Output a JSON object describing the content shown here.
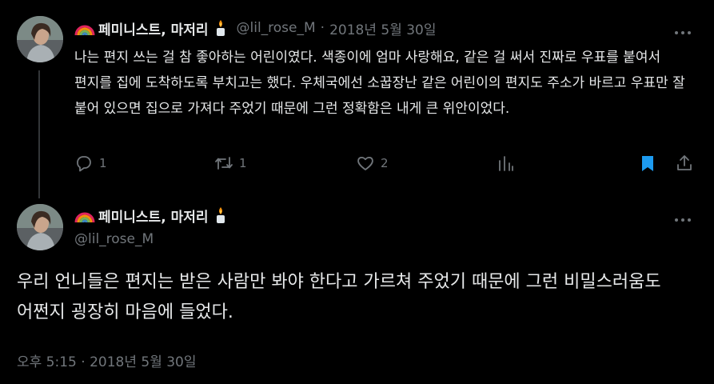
{
  "first_tweet": {
    "display_name": "페미니스트, 마저리",
    "handle": "@lil_rose_M",
    "separator": "·",
    "date": "2018년 5월 30일",
    "text": "나는 편지 쓰는 걸 참 좋아하는 어린이였다. 색종이에 엄마 사랑해요, 같은 걸 써서 진짜로 우표를 붙여서 편지를 집에 도착하도록 부치고는 했다. 우체국에선 소꿉장난 같은 어린이의 편지도 주소가 바르고 우표만 잘 붙어 있으면 집으로 가져다 주었기 때문에 그런 정확함은 내게 큰 위안이었다.",
    "actions": {
      "reply_count": "1",
      "retweet_count": "1",
      "like_count": "2"
    }
  },
  "second_tweet": {
    "display_name": "페미니스트, 마저리",
    "handle": "@lil_rose_M",
    "text": "우리 언니들은 편지는 받은 사람만 봐야 한다고 가르쳐 주었기 때문에 그런 비밀스러움도 어쩐지 굉장히 마음에 들었다.",
    "time": "오후 5:15",
    "separator": "·",
    "date": "2018년 5월 30일"
  },
  "icons": {
    "name_prefix": "rainbow-icon",
    "name_suffix": "candle-icon",
    "more": "more-icon",
    "reply": "reply-icon",
    "retweet": "retweet-icon",
    "like": "heart-icon",
    "views": "views-icon",
    "bookmark": "bookmark-icon",
    "share": "share-icon"
  },
  "colors": {
    "background": "#000000",
    "text_primary": "#e7e9ea",
    "text_secondary": "#71767b",
    "bookmark_active": "#1d9bf0",
    "thread_line": "#333639"
  }
}
